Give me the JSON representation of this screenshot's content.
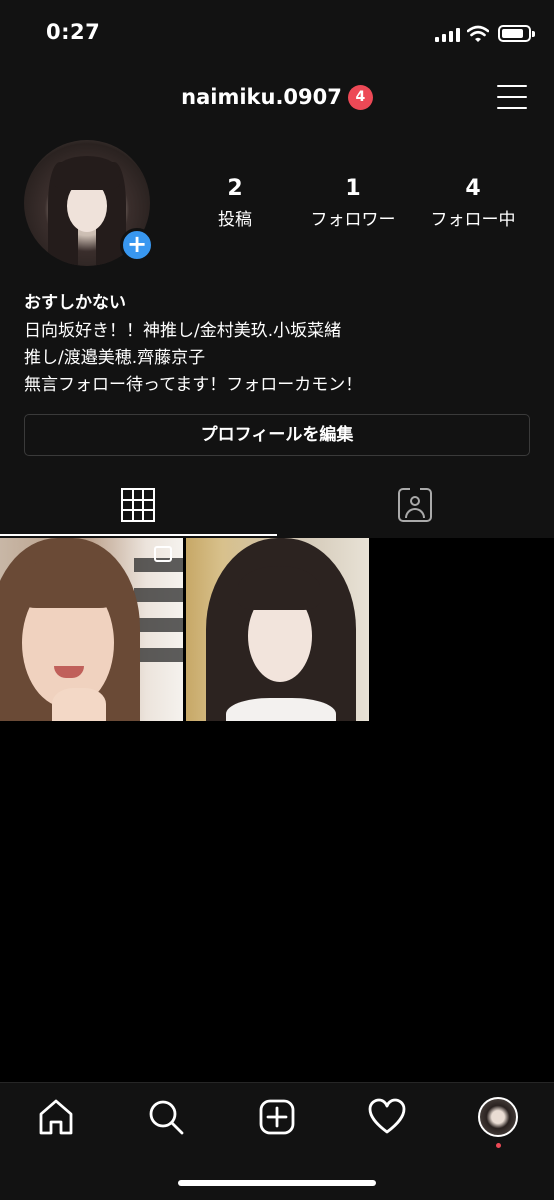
{
  "status_bar": {
    "time": "0:27"
  },
  "header": {
    "username": "naimiku.0907",
    "notification_count": "4",
    "menu_icon": "hamburger-menu-icon"
  },
  "profile": {
    "add_story_icon": "plus-icon",
    "stats": [
      {
        "num": "2",
        "label": "投稿"
      },
      {
        "num": "1",
        "label": "フォロワー"
      },
      {
        "num": "4",
        "label": "フォロー中"
      }
    ],
    "display_name": "おすしかない",
    "bio_lines": [
      "日向坂好き！！神推し/金村美玖.小坂菜緒",
      "推し/渡邉美穂.齊藤京子",
      "無言フォロー待ってます！フォローカモン！"
    ],
    "edit_button_label": "プロフィールを編集"
  },
  "tabs": [
    {
      "icon": "grid-icon",
      "active": true
    },
    {
      "icon": "tagged-person-icon",
      "active": false
    }
  ],
  "posts": [
    {
      "icon": "multiple-photos-icon"
    },
    {}
  ],
  "bottom_nav": [
    "home-icon",
    "search-icon",
    "new-post-icon",
    "heart-icon",
    "profile-avatar"
  ],
  "colors": {
    "background": "#000000",
    "header_background": "#121212",
    "badge_red": "#ed4956",
    "accent_blue": "#3897f0"
  }
}
